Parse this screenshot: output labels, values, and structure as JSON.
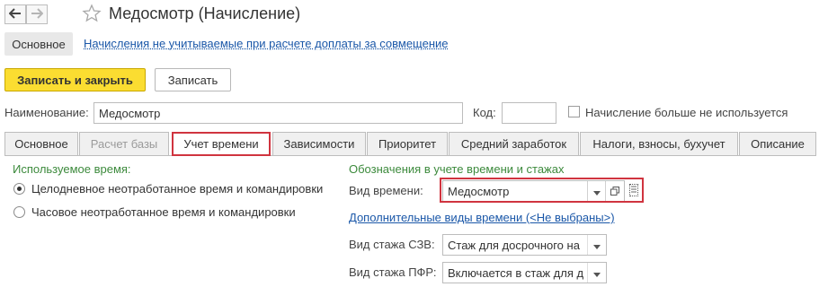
{
  "window": {
    "title": "Медосмотр (Начисление)"
  },
  "modes": {
    "main": "Основное",
    "link": "Начисления не учитываемые при расчете доплаты за совмещение"
  },
  "toolbar": {
    "save_close": "Записать и закрыть",
    "save": "Записать"
  },
  "fields": {
    "name_label": "Наименование:",
    "name_value": "Медосмотр",
    "code_label": "Код:",
    "code_value": "",
    "unused_label": "Начисление больше не используется"
  },
  "tabs": [
    {
      "label": "Основное"
    },
    {
      "label": "Расчет базы"
    },
    {
      "label": "Учет времени"
    },
    {
      "label": "Зависимости"
    },
    {
      "label": "Приоритет"
    },
    {
      "label": "Средний заработок"
    },
    {
      "label": "Налоги, взносы, бухучет"
    },
    {
      "label": "Описание"
    }
  ],
  "time_usage": {
    "title": "Используемое время:",
    "option_full_day": "Целодневное неотработанное время и командировки",
    "option_hourly": "Часовое неотработанное время и командировки"
  },
  "designations": {
    "title": "Обозначения в учете времени и стажах",
    "time_type_label": "Вид времени:",
    "time_type_value": "Медосмотр",
    "extra_types_link": "Дополнительные виды времени (<Не выбраны>)",
    "szv_label": "Вид стажа СЗВ:",
    "szv_value": "Стаж для досрочного на",
    "pfr_label": "Вид стажа ПФР:",
    "pfr_value": "Включается в стаж для д"
  },
  "colors": {
    "accent_yellow": "#fbdd31",
    "highlight_red": "#d0343f",
    "group_green": "#3c8a3c",
    "link_blue": "#1a57a8"
  }
}
